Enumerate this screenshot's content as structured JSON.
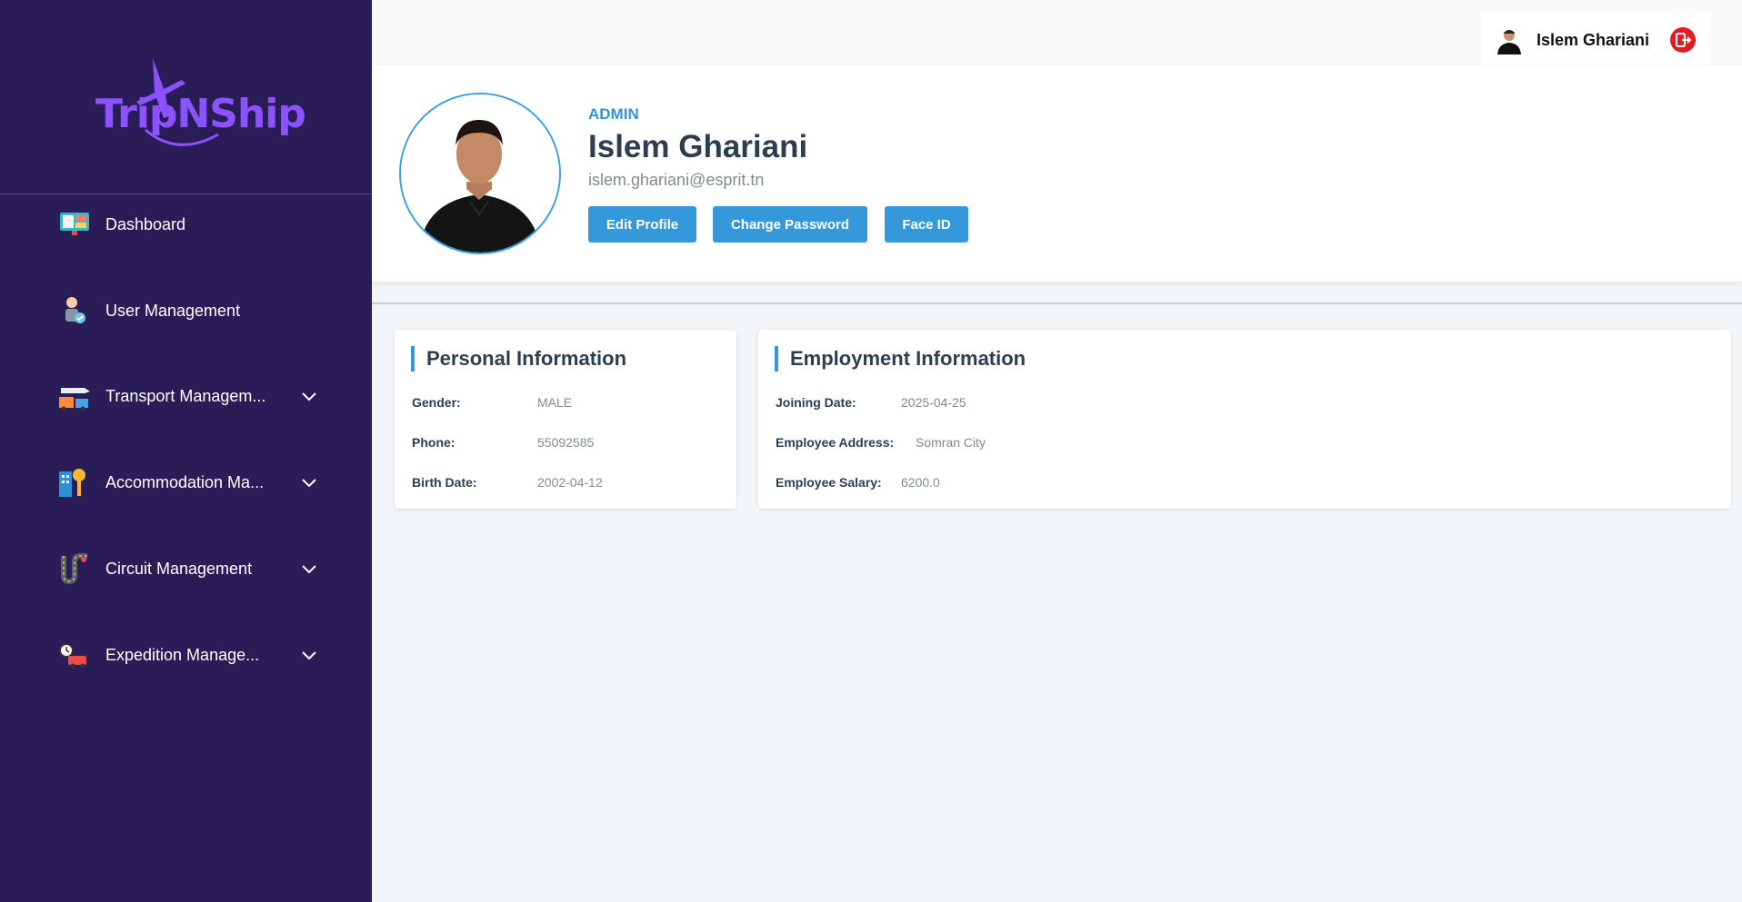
{
  "brand": {
    "name": "TripNShip"
  },
  "sidebar": {
    "items": [
      {
        "label": "Dashboard",
        "icon": "dashboard-icon",
        "expandable": false
      },
      {
        "label": "User Management",
        "icon": "user-management-icon",
        "expandable": false
      },
      {
        "label": "Transport Managem...",
        "icon": "transport-icon",
        "expandable": true
      },
      {
        "label": "Accommodation Ma...",
        "icon": "accommodation-icon",
        "expandable": true
      },
      {
        "label": "Circuit Management",
        "icon": "circuit-icon",
        "expandable": true
      },
      {
        "label": "Expedition Manage...",
        "icon": "expedition-icon",
        "expandable": true
      }
    ]
  },
  "topbar": {
    "user_name": "Islem Ghariani",
    "logout_icon": "logout-icon"
  },
  "profile": {
    "role": "ADMIN",
    "name": "Islem Ghariani",
    "email": "islem.ghariani@esprit.tn",
    "buttons": {
      "edit": "Edit Profile",
      "change_password": "Change Password",
      "face_id": "Face ID"
    }
  },
  "personal": {
    "title": "Personal Information",
    "gender_label": "Gender:",
    "gender": "MALE",
    "phone_label": "Phone:",
    "phone": "55092585",
    "birth_label": "Birth Date:",
    "birth": "2002-04-12"
  },
  "employment": {
    "title": "Employment Information",
    "joining_label": "Joining Date:",
    "joining": "2025-04-25",
    "address_label": "Employee Address:",
    "address": "Somran City",
    "salary_label": "Employee Salary:",
    "salary": "6200.0"
  },
  "colors": {
    "sidebar": "#2a1d57",
    "accent": "#3498db",
    "brand": "#8c52ff",
    "logout": "#e31b23"
  }
}
